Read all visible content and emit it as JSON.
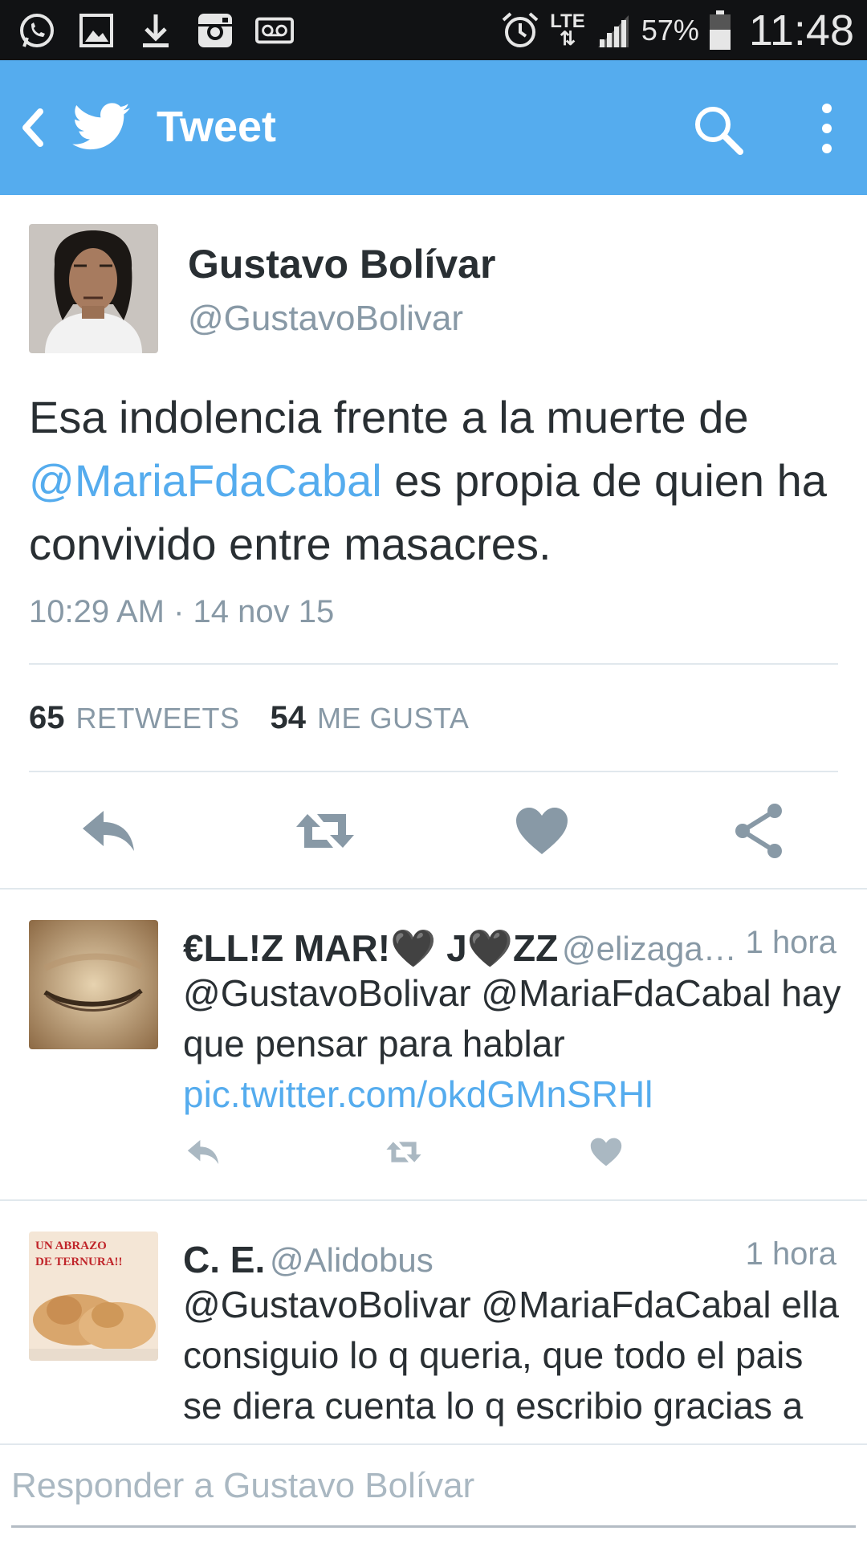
{
  "status_bar": {
    "network": "LTE",
    "battery": "57%",
    "time": "11:48",
    "icons": [
      "whatsapp-icon",
      "gallery-icon",
      "download-icon",
      "instagram-icon",
      "voicemail-icon",
      "alarm-icon",
      "signal-icon",
      "battery-icon"
    ]
  },
  "app_bar": {
    "title": "Tweet",
    "icons": [
      "back-icon",
      "twitter-bird-icon",
      "search-icon",
      "more-options-icon"
    ],
    "color": "#55acee"
  },
  "tweet": {
    "author_name": "Gustavo Bolívar",
    "author_handle": "@GustavoBolivar",
    "text_before": "Esa indolencia frente a la muerte de ",
    "mention": "@MariaFdaCabal",
    "text_after": " es propia de quien ha convivido entre masacres.",
    "timestamp": "10:29 AM · 14 nov 15",
    "retweets_count": "65",
    "retweets_label": "RETWEETS",
    "likes_count": "54",
    "likes_label": "ME GUSTA",
    "actions": [
      "reply-icon",
      "retweet-icon",
      "like-icon",
      "share-icon"
    ]
  },
  "replies": [
    {
      "name": "€LL!Z MAR!🖤 J🖤ZZ",
      "handle": "@elizagal...",
      "time": "1 hora",
      "text": "@GustavoBolivar @MariaFdaCabal hay que pensar para hablar",
      "link": "pic.twitter.com/okdGMnSRHl"
    },
    {
      "name": "C. E.",
      "handle": "@Alidobus",
      "time": "1 hora",
      "text": "@GustavoBolivar @MariaFdaCabal ella consiguio lo q queria, que todo el pais se diera cuenta lo q escribio gracias a muchos como usted",
      "avatar_text_1": "UN ABRAZO",
      "avatar_text_2": "DE TERNURA!!"
    }
  ],
  "composer": {
    "placeholder": "Responder a Gustavo Bolívar"
  },
  "colors": {
    "accent": "#55acee",
    "muted": "#8899a6",
    "action_icon": "#8899a6"
  }
}
